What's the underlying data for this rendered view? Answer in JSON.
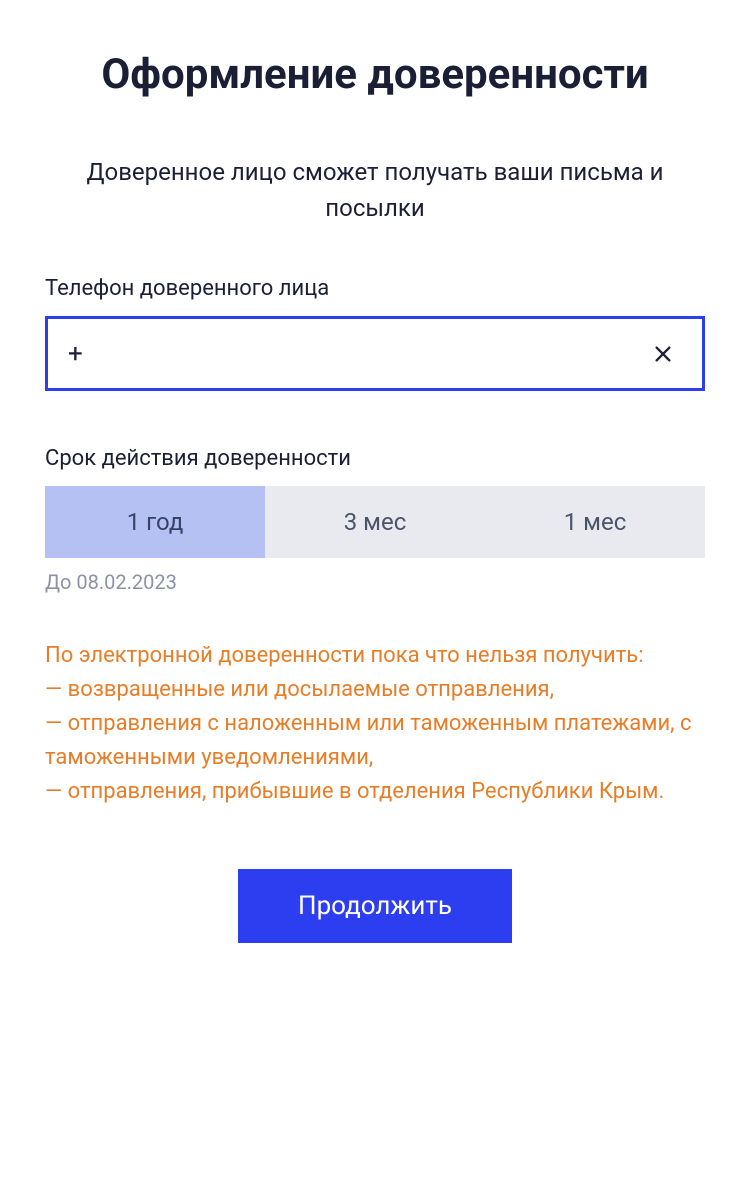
{
  "title": "Оформление доверенности",
  "description": "Доверенное лицо сможет получать ваши письма и посылки",
  "phone": {
    "label": "Телефон доверенного лица",
    "value": "+"
  },
  "validity": {
    "label": "Срок действия доверенности",
    "options": [
      "1 год",
      "3 мес",
      "1 мес"
    ],
    "selected": 0,
    "until": "До 08.02.2023"
  },
  "warning": {
    "intro": "По электронной доверенности пока что нельзя получить:",
    "items": [
      "— возвращенные или досылаемые отправления,",
      "— отправления с наложенным или таможенным платежами, с таможенными уведомлениями,",
      "— отправления, прибывшие в отделения Республики Крым."
    ]
  },
  "continueLabel": "Продолжить"
}
